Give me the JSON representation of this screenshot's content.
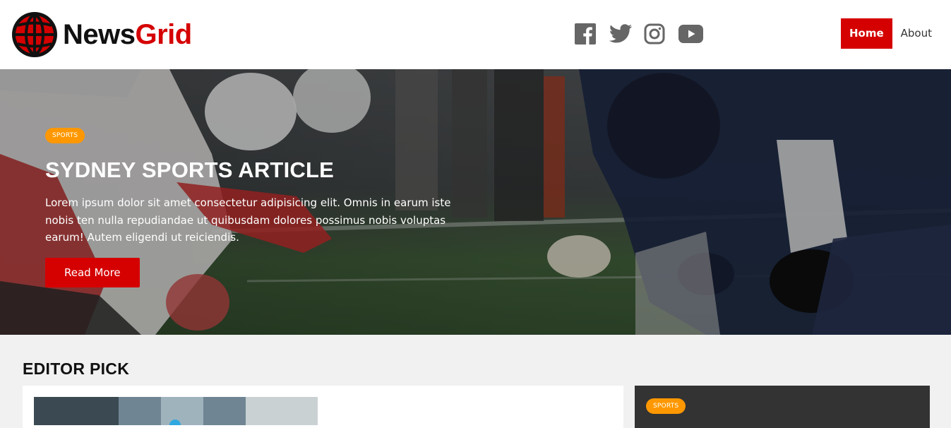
{
  "brand": {
    "name_part1": "News",
    "name_part2": "Grid",
    "accent": "#d50000"
  },
  "social": [
    {
      "icon": "facebook-icon"
    },
    {
      "icon": "twitter-icon"
    },
    {
      "icon": "instagram-icon"
    },
    {
      "icon": "youtube-icon"
    }
  ],
  "nav": {
    "items": [
      {
        "label": "Home",
        "active": true
      },
      {
        "label": "About",
        "active": false
      }
    ]
  },
  "hero": {
    "badge": "SPORTS",
    "title": "SYDNEY SPORTS ARTICLE",
    "text": "Lorem ipsum dolor sit amet consectetur adipisicing elit. Omnis in earum iste nobis ten nulla repudiandae ut quibusdam dolores possimus nobis voluptas earum! Autem eligendi ut reiciendis.",
    "button": "Read More",
    "badge_color": "#ff9800"
  },
  "editor_pick": {
    "title": "EDITOR PICK",
    "right_card_badge": "SPORTS"
  }
}
